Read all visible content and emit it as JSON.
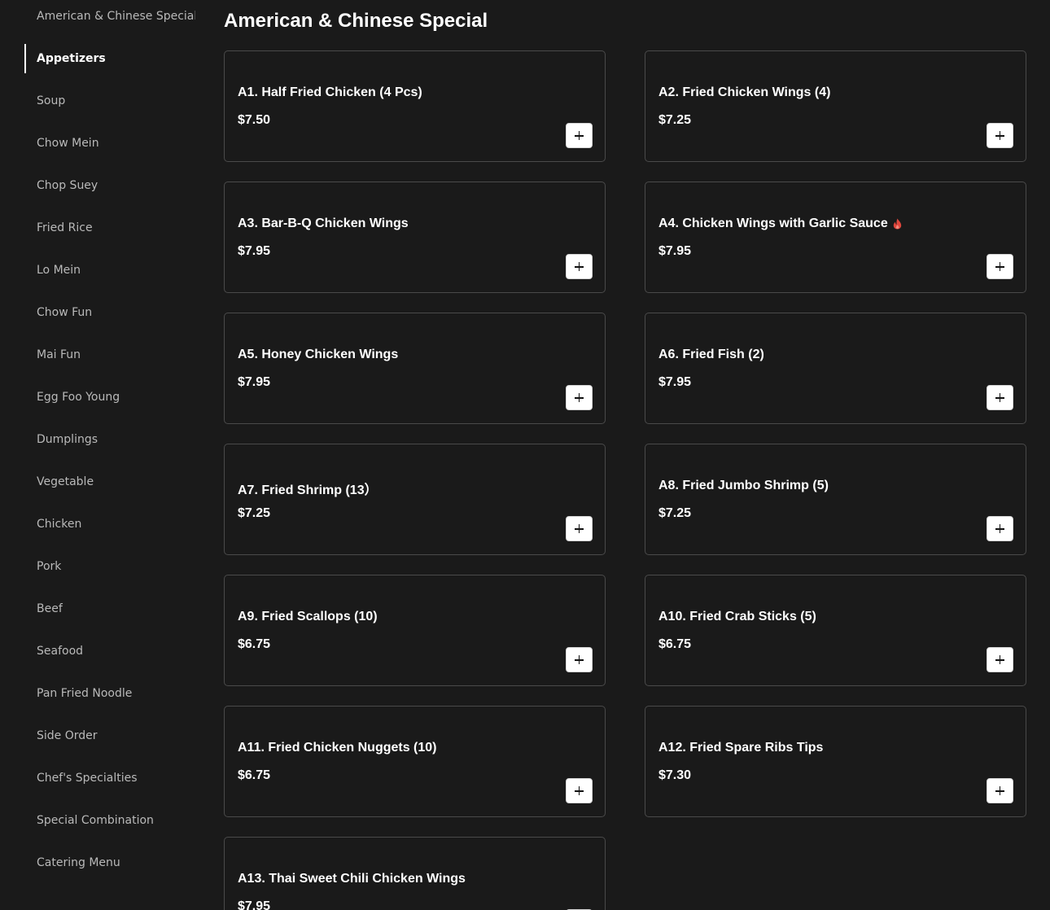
{
  "sidebar": {
    "items": [
      {
        "label": "American & Chinese Special",
        "active": false
      },
      {
        "label": "Appetizers",
        "active": true
      },
      {
        "label": "Soup",
        "active": false
      },
      {
        "label": "Chow Mein",
        "active": false
      },
      {
        "label": "Chop Suey",
        "active": false
      },
      {
        "label": "Fried Rice",
        "active": false
      },
      {
        "label": "Lo Mein",
        "active": false
      },
      {
        "label": "Chow Fun",
        "active": false
      },
      {
        "label": "Mai Fun",
        "active": false
      },
      {
        "label": "Egg Foo Young",
        "active": false
      },
      {
        "label": "Dumplings",
        "active": false
      },
      {
        "label": "Vegetable",
        "active": false
      },
      {
        "label": "Chicken",
        "active": false
      },
      {
        "label": "Pork",
        "active": false
      },
      {
        "label": "Beef",
        "active": false
      },
      {
        "label": "Seafood",
        "active": false
      },
      {
        "label": "Pan Fried Noodle",
        "active": false
      },
      {
        "label": "Side Order",
        "active": false
      },
      {
        "label": "Chef's Specialties",
        "active": false
      },
      {
        "label": "Special Combination",
        "active": false
      },
      {
        "label": "Catering Menu",
        "active": false
      }
    ]
  },
  "main": {
    "title": "American & Chinese Special",
    "items": [
      {
        "name": "A1. Half Fried Chicken (4 Pcs)",
        "price": "$7.50",
        "spicy": false
      },
      {
        "name": "A2. Fried Chicken Wings (4)",
        "price": "$7.25",
        "spicy": false
      },
      {
        "name": "A3. Bar-B-Q Chicken Wings",
        "price": "$7.95",
        "spicy": false
      },
      {
        "name": "A4. Chicken Wings with Garlic Sauce",
        "price": "$7.95",
        "spicy": true
      },
      {
        "name": "A5. Honey Chicken Wings",
        "price": "$7.95",
        "spicy": false
      },
      {
        "name": "A6. Fried Fish (2)",
        "price": "$7.95",
        "spicy": false
      },
      {
        "name": "A7. Fried Shrimp (13）",
        "price": "$7.25",
        "spicy": false
      },
      {
        "name": "A8. Fried Jumbo Shrimp (5)",
        "price": "$7.25",
        "spicy": false
      },
      {
        "name": "A9. Fried Scallops (10)",
        "price": "$6.75",
        "spicy": false
      },
      {
        "name": "A10. Fried Crab Sticks (5)",
        "price": "$6.75",
        "spicy": false
      },
      {
        "name": "A11. Fried Chicken Nuggets (10)",
        "price": "$6.75",
        "spicy": false
      },
      {
        "name": "A12. Fried Spare Ribs Tips",
        "price": "$7.30",
        "spicy": false
      },
      {
        "name": "A13. Thai Sweet Chili Chicken Wings",
        "price": "$7.95",
        "spicy": false
      }
    ]
  },
  "colors": {
    "background": "#1a1a1a",
    "card_border": "#4a4a4a",
    "sidebar_text": "#b9b9b9",
    "active_text": "#ffffff",
    "spicy_icon": "#e0463c"
  },
  "icons": {
    "add": "plus-icon",
    "spicy": "spicy-icon"
  }
}
